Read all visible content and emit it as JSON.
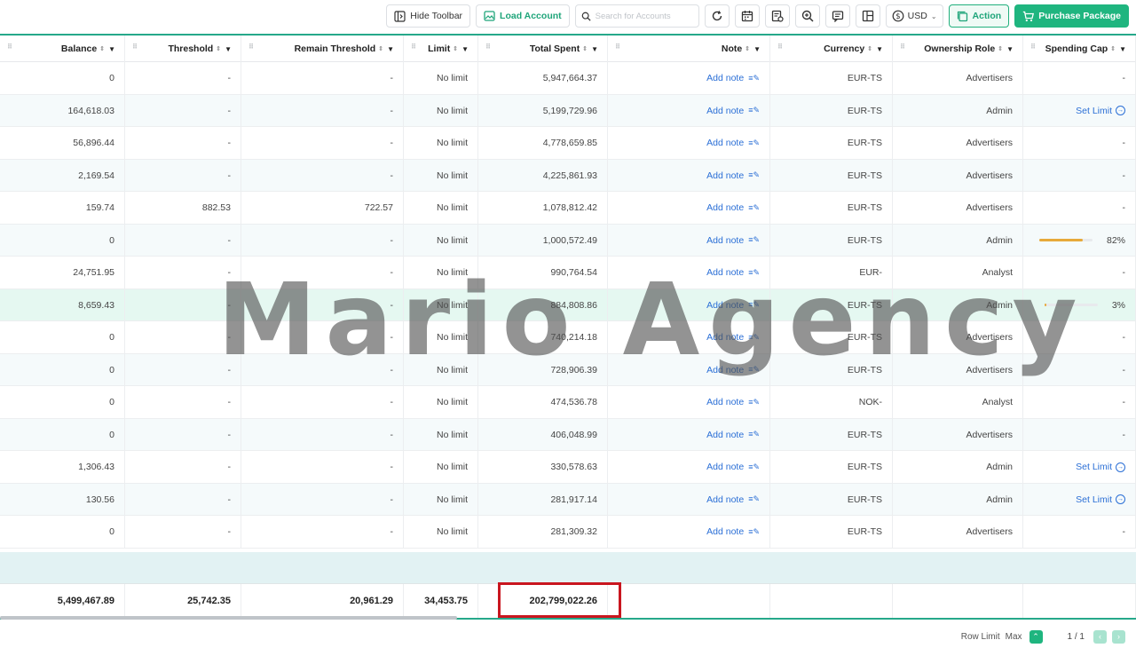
{
  "toolbar": {
    "hide_toolbar_label": "Hide Toolbar",
    "load_account_label": "Load Account",
    "search_placeholder": "Search for Accounts",
    "currency": "USD",
    "action_label": "Action",
    "purchase_label": "Purchase Package"
  },
  "columns": [
    {
      "key": "balance",
      "label": "Balance",
      "sortable": true
    },
    {
      "key": "threshold",
      "label": "Threshold",
      "sortable": true
    },
    {
      "key": "remain_threshold",
      "label": "Remain Threshold",
      "sortable": true
    },
    {
      "key": "limit",
      "label": "Limit",
      "sortable": true
    },
    {
      "key": "total_spent",
      "label": "Total Spent",
      "sortable": true
    },
    {
      "key": "note",
      "label": "Note",
      "sortable": true
    },
    {
      "key": "currency",
      "label": "Currency",
      "sortable": true
    },
    {
      "key": "ownership_role",
      "label": "Ownership Role",
      "sortable": true
    },
    {
      "key": "spending_cap",
      "label": "Spending Cap",
      "sortable": true
    }
  ],
  "rows": [
    {
      "balance": "0",
      "threshold": "-",
      "remain_threshold": "-",
      "limit": "No limit",
      "total_spent": "5,947,664.37",
      "note": "Add note",
      "currency": "EUR-TS",
      "ownership_role": "Advertisers",
      "spending_cap": {
        "kind": "text",
        "text": "-"
      }
    },
    {
      "balance": "164,618.03",
      "threshold": "-",
      "remain_threshold": "-",
      "limit": "No limit",
      "total_spent": "5,199,729.96",
      "note": "Add note",
      "currency": "EUR-TS",
      "ownership_role": "Admin",
      "spending_cap": {
        "kind": "link",
        "text": "Set Limit"
      }
    },
    {
      "balance": "56,896.44",
      "threshold": "-",
      "remain_threshold": "-",
      "limit": "No limit",
      "total_spent": "4,778,659.85",
      "note": "Add note",
      "currency": "EUR-TS",
      "ownership_role": "Advertisers",
      "spending_cap": {
        "kind": "text",
        "text": "-"
      }
    },
    {
      "balance": "2,169.54",
      "threshold": "-",
      "remain_threshold": "-",
      "limit": "No limit",
      "total_spent": "4,225,861.93",
      "note": "Add note",
      "currency": "EUR-TS",
      "ownership_role": "Advertisers",
      "spending_cap": {
        "kind": "text",
        "text": "-"
      }
    },
    {
      "balance": "159.74",
      "threshold": "882.53",
      "remain_threshold": "722.57",
      "limit": "No limit",
      "total_spent": "1,078,812.42",
      "note": "Add note",
      "currency": "EUR-TS",
      "ownership_role": "Advertisers",
      "spending_cap": {
        "kind": "text",
        "text": "-"
      }
    },
    {
      "balance": "0",
      "threshold": "-",
      "remain_threshold": "-",
      "limit": "No limit",
      "total_spent": "1,000,572.49",
      "note": "Add note",
      "currency": "EUR-TS",
      "ownership_role": "Admin",
      "spending_cap": {
        "kind": "progress",
        "text": "82%",
        "percent": 82
      }
    },
    {
      "balance": "24,751.95",
      "threshold": "-",
      "remain_threshold": "-",
      "limit": "No limit",
      "total_spent": "990,764.54",
      "note": "Add note",
      "currency": "EUR-",
      "ownership_role": "Analyst",
      "spending_cap": {
        "kind": "text",
        "text": "-"
      }
    },
    {
      "balance": "8,659.43",
      "threshold": "-",
      "remain_threshold": "-",
      "limit": "No limit",
      "total_spent": "884,808.86",
      "note": "Add note",
      "currency": "EUR-TS",
      "ownership_role": "Admin",
      "spending_cap": {
        "kind": "progress",
        "text": "3%",
        "percent": 3
      },
      "highlighted": true
    },
    {
      "balance": "0",
      "threshold": "-",
      "remain_threshold": "-",
      "limit": "No limit",
      "total_spent": "740,214.18",
      "note": "Add note",
      "currency": "EUR-TS",
      "ownership_role": "Advertisers",
      "spending_cap": {
        "kind": "text",
        "text": "-"
      }
    },
    {
      "balance": "0",
      "threshold": "-",
      "remain_threshold": "-",
      "limit": "No limit",
      "total_spent": "728,906.39",
      "note": "Add note",
      "currency": "EUR-TS",
      "ownership_role": "Advertisers",
      "spending_cap": {
        "kind": "text",
        "text": "-"
      }
    },
    {
      "balance": "0",
      "threshold": "-",
      "remain_threshold": "-",
      "limit": "No limit",
      "total_spent": "474,536.78",
      "note": "Add note",
      "currency": "NOK-",
      "ownership_role": "Analyst",
      "spending_cap": {
        "kind": "text",
        "text": "-"
      }
    },
    {
      "balance": "0",
      "threshold": "-",
      "remain_threshold": "-",
      "limit": "No limit",
      "total_spent": "406,048.99",
      "note": "Add note",
      "currency": "EUR-TS",
      "ownership_role": "Advertisers",
      "spending_cap": {
        "kind": "text",
        "text": "-"
      }
    },
    {
      "balance": "1,306.43",
      "threshold": "-",
      "remain_threshold": "-",
      "limit": "No limit",
      "total_spent": "330,578.63",
      "note": "Add note",
      "currency": "EUR-TS",
      "ownership_role": "Admin",
      "spending_cap": {
        "kind": "link",
        "text": "Set Limit"
      }
    },
    {
      "balance": "130.56",
      "threshold": "-",
      "remain_threshold": "-",
      "limit": "No limit",
      "total_spent": "281,917.14",
      "note": "Add note",
      "currency": "EUR-TS",
      "ownership_role": "Admin",
      "spending_cap": {
        "kind": "link",
        "text": "Set Limit"
      }
    },
    {
      "balance": "0",
      "threshold": "-",
      "remain_threshold": "-",
      "limit": "No limit",
      "total_spent": "281,309.32",
      "note": "Add note",
      "currency": "EUR-TS",
      "ownership_role": "Advertisers",
      "spending_cap": {
        "kind": "text",
        "text": "-"
      }
    }
  ],
  "totals": {
    "balance": "5,499,467.89",
    "threshold": "25,742.35",
    "remain_threshold": "20,961.29",
    "limit": "34,453.75",
    "total_spent": "202,799,022.26"
  },
  "footer": {
    "row_limit_label": "Row Limit",
    "row_limit_value": "Max",
    "page_indicator": "1 / 1"
  },
  "watermark": "Mario Agency",
  "colors": {
    "accent": "#1fb57f",
    "link": "#2b6fd6",
    "highlight_box": "#c9161f",
    "progress": "#e7a93a"
  }
}
